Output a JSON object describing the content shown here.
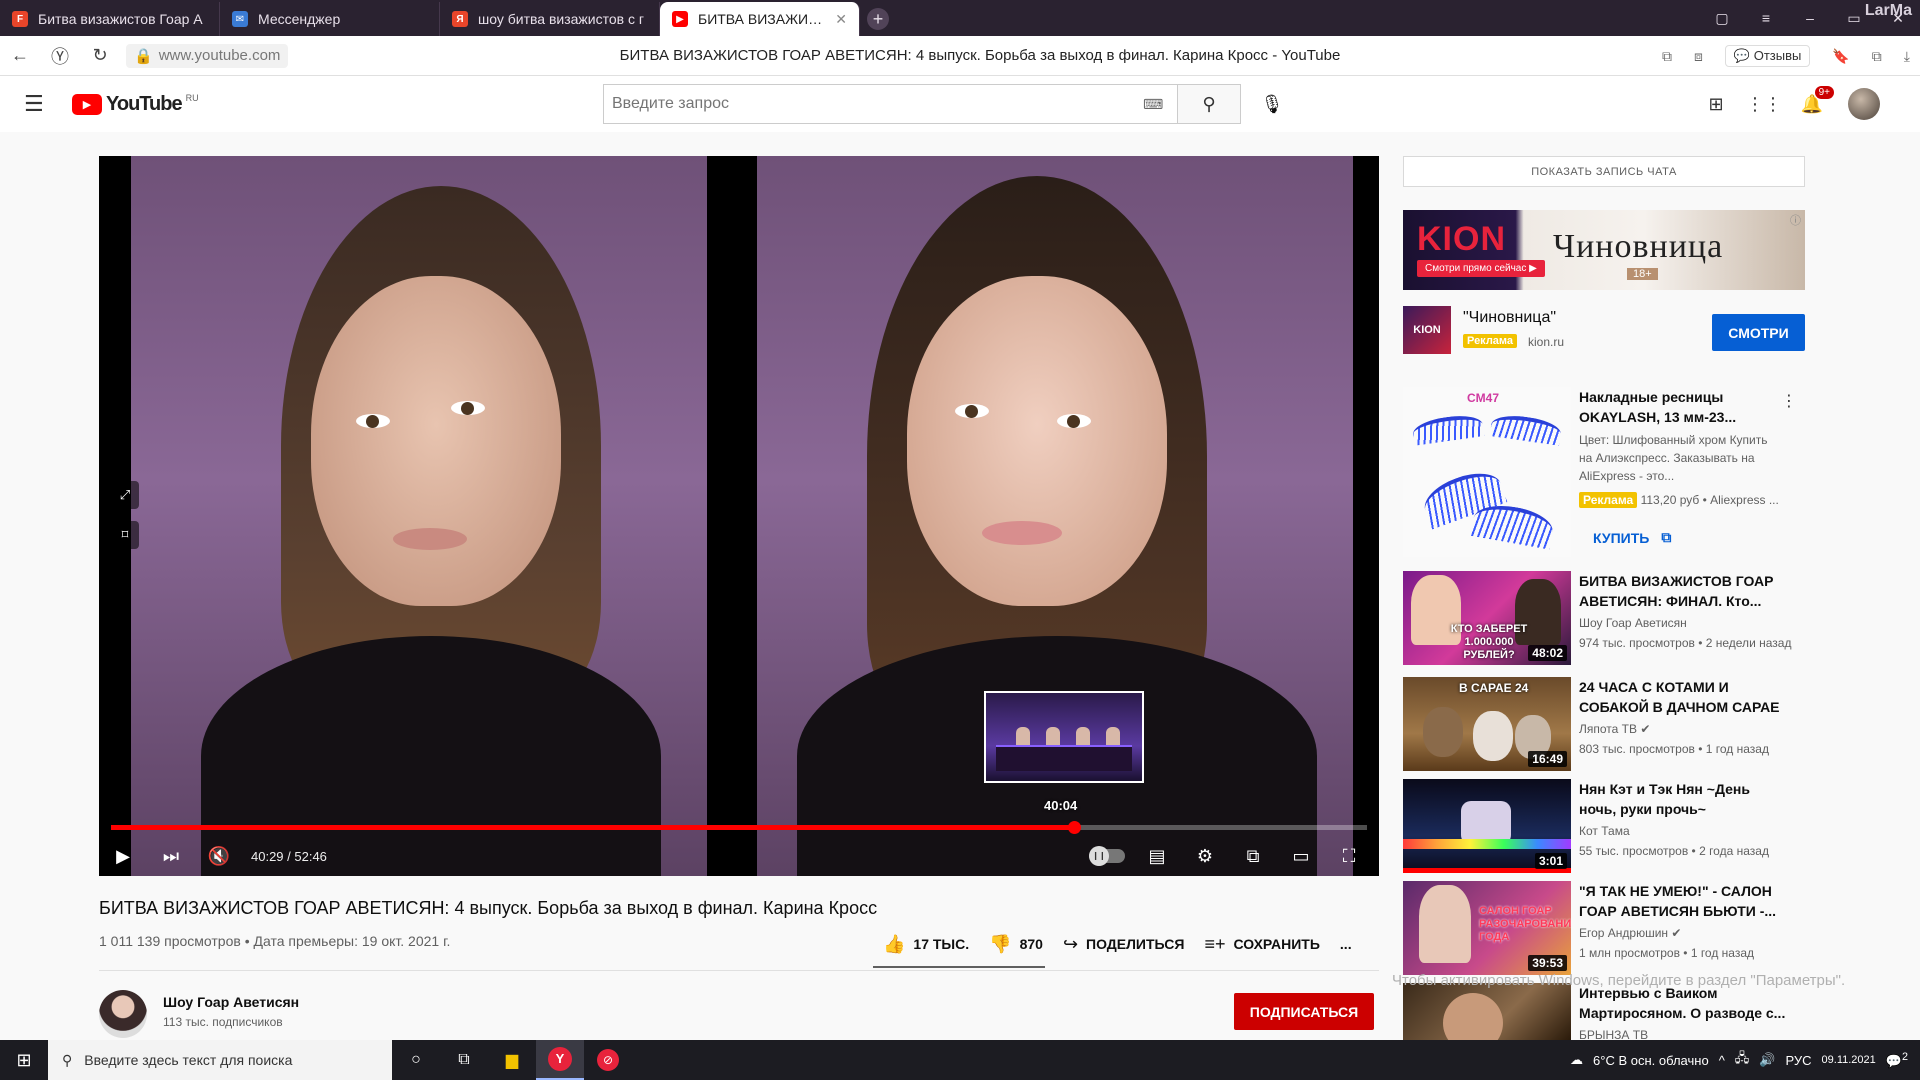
{
  "browser": {
    "tabs": [
      {
        "label": "Битва визажистов Гоар А",
        "icon": "favicon-red"
      },
      {
        "label": "Мессенджер",
        "icon": "messenger-icon"
      },
      {
        "label": "шоу битва визажистов с г",
        "icon": "yandex-icon"
      },
      {
        "label": "БИТВА ВИЗАЖИСТОВ Г",
        "icon": "youtube-icon"
      }
    ],
    "profile_name": "LarMa",
    "url": "www.youtube.com",
    "page_title": "БИТВА ВИЗАЖИСТОВ ГОАР АВЕТИСЯН: 4 выпуск. Борьба за выход в финал. Карина Кросс - YouTube",
    "feedback_label": "Отзывы"
  },
  "header": {
    "logo_text": "YouTube",
    "logo_region": "RU",
    "search_placeholder": "Введите запрос",
    "notifications_count": "9+"
  },
  "player": {
    "current_time": "40:29",
    "duration": "52:46",
    "time_display": "40:29 / 52:46",
    "progress_fraction": 0.767,
    "preview_time": "40:04",
    "muted": true
  },
  "video": {
    "title": "БИТВА ВИЗАЖИСТОВ ГОАР АВЕТИСЯН: 4 выпуск. Борьба за выход в финал. Карина Кросс",
    "meta": "1 011 139 просмотров • Дата премьеры: 19 окт. 2021 г.",
    "likes": "17 ТЫС.",
    "dislikes": "870",
    "share_label": "ПОДЕЛИТЬСЯ",
    "save_label": "СОХРАНИТЬ",
    "more_label": "..."
  },
  "channel": {
    "name": "Шоу Гоар Аветисян",
    "subscribers": "113 тыс. подписчиков",
    "subscribe_label": "ПОДПИСАТЬСЯ"
  },
  "sidebar": {
    "chat_button": "ПОКАЗАТЬ ЗАПИСЬ ЧАТА",
    "ad_banner": {
      "brand": "KION",
      "cta": "Смотри прямо сейчас ▶",
      "title": "Чиновница",
      "age": "18+"
    },
    "ad": {
      "logo": "KION",
      "name": "\"Чиновница\"",
      "badge": "Реклама",
      "domain": "kion.ru",
      "button": "СМОТРИ"
    },
    "product": {
      "brand": "CM47",
      "title": "Накладные ресницы OKAYLASH, 13 мм-23...",
      "desc": "Цвет: Шлифованный хром Купить на Алиэкспресс. Заказывать на AliExpress - это...",
      "badge": "Реклама",
      "meta": "113,20 руб • Aliexpress ...",
      "buy": "КУПИТЬ"
    },
    "recommendations": [
      {
        "title": "БИТВА ВИЗАЖИСТОВ ГОАР АВЕТИСЯН: ФИНАЛ. Кто...",
        "channel": "Шоу Гоар Аветисян",
        "views": "974 тыс. просмотров • 2 недели назад",
        "duration": "48:02",
        "thumb_text": "КТО ЗАБЕРЕТ 1.000.000 РУБЛЕЙ?"
      },
      {
        "title": "24 ЧАСА С КОТАМИ И СОБАКОЙ В ДАЧНОМ САРАЕ",
        "channel": "Ляпота ТВ",
        "views": "803 тыс. просмотров • 1 год назад",
        "duration": "16:49",
        "thumb_text": "В САРАЕ 24"
      },
      {
        "title": "Нян Кэт и Тэк Нян ~День ночь, руки прочь~",
        "channel": "Кот Тама",
        "views": "55 тыс. просмотров • 2 года назад",
        "duration": "3:01",
        "thumb_text": ""
      },
      {
        "title": "\"Я ТАК НЕ УМЕЮ!\" - САЛОН ГОАР АВЕТИСЯН БЬЮТИ -...",
        "channel": "Егор Андрюшин",
        "views": "1 млн просмотров • 1 год назад",
        "duration": "39:53",
        "thumb_text": "САЛОН ГОАР РАЗОЧАРОВАНИЕ ГОДА"
      },
      {
        "title": "Интервью с Ваиком Мартиросяном. О разводе с...",
        "channel": "БРЫНЗА ТВ",
        "views": "",
        "duration": "",
        "thumb_text": ""
      }
    ],
    "activation_watermark": "Чтобы активировать Windows, перейдите в раздел \"Параметры\"."
  },
  "taskbar": {
    "search_placeholder": "Введите здесь текст для поиска",
    "weather": "6°C  В осн. облачно",
    "language": "РУС",
    "date": "09.11.2021",
    "notifications": "2"
  },
  "colors": {
    "youtube_red": "#ff0000",
    "subscribe_red": "#cc0000",
    "link_blue": "#065fd4",
    "ad_badge_yellow": "#f2c200"
  }
}
